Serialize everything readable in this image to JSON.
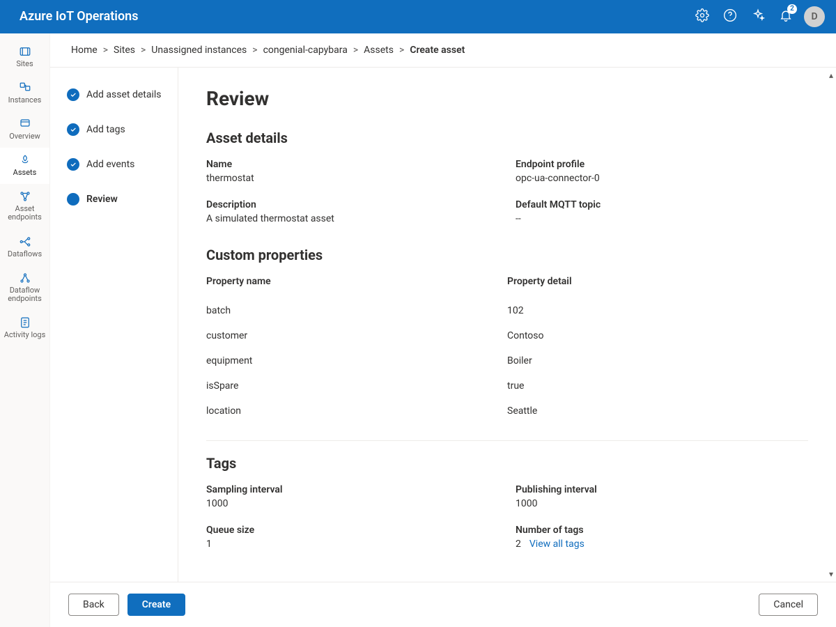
{
  "header": {
    "brand": "Azure IoT Operations",
    "notification_count": "2",
    "avatar_initial": "D"
  },
  "leftnav": {
    "items": [
      {
        "label": "Sites",
        "name": "nav-sites"
      },
      {
        "label": "Instances",
        "name": "nav-instances"
      },
      {
        "label": "Overview",
        "name": "nav-overview"
      },
      {
        "label": "Assets",
        "name": "nav-assets"
      },
      {
        "label": "Asset endpoints",
        "name": "nav-asset-endpoints"
      },
      {
        "label": "Dataflows",
        "name": "nav-dataflows"
      },
      {
        "label": "Dataflow endpoints",
        "name": "nav-dataflow-endpoints"
      },
      {
        "label": "Activity logs",
        "name": "nav-activity-logs"
      }
    ]
  },
  "breadcrumb": {
    "items": [
      "Home",
      "Sites",
      "Unassigned instances",
      "congenial-capybara",
      "Assets"
    ],
    "current": "Create asset"
  },
  "steps": [
    {
      "label": "Add asset details",
      "done": true
    },
    {
      "label": "Add tags",
      "done": true
    },
    {
      "label": "Add events",
      "done": true
    },
    {
      "label": "Review",
      "done": false,
      "current": true
    }
  ],
  "review": {
    "title": "Review",
    "asset_details": {
      "heading": "Asset details",
      "name_label": "Name",
      "name_value": "thermostat",
      "endpoint_label": "Endpoint profile",
      "endpoint_value": "opc-ua-connector-0",
      "description_label": "Description",
      "description_value": "A simulated thermostat asset",
      "mqtt_label": "Default MQTT topic",
      "mqtt_value": "--"
    },
    "custom_properties": {
      "heading": "Custom properties",
      "col_name": "Property name",
      "col_detail": "Property detail",
      "rows": [
        {
          "name": "batch",
          "detail": "102"
        },
        {
          "name": "customer",
          "detail": "Contoso"
        },
        {
          "name": "equipment",
          "detail": "Boiler"
        },
        {
          "name": "isSpare",
          "detail": "true"
        },
        {
          "name": "location",
          "detail": "Seattle"
        }
      ]
    },
    "tags": {
      "heading": "Tags",
      "sampling_label": "Sampling interval",
      "sampling_value": "1000",
      "publishing_label": "Publishing interval",
      "publishing_value": "1000",
      "queue_label": "Queue size",
      "queue_value": "1",
      "count_label": "Number of tags",
      "count_value": "2",
      "view_all": "View all tags"
    }
  },
  "footer": {
    "back": "Back",
    "create": "Create",
    "cancel": "Cancel"
  }
}
